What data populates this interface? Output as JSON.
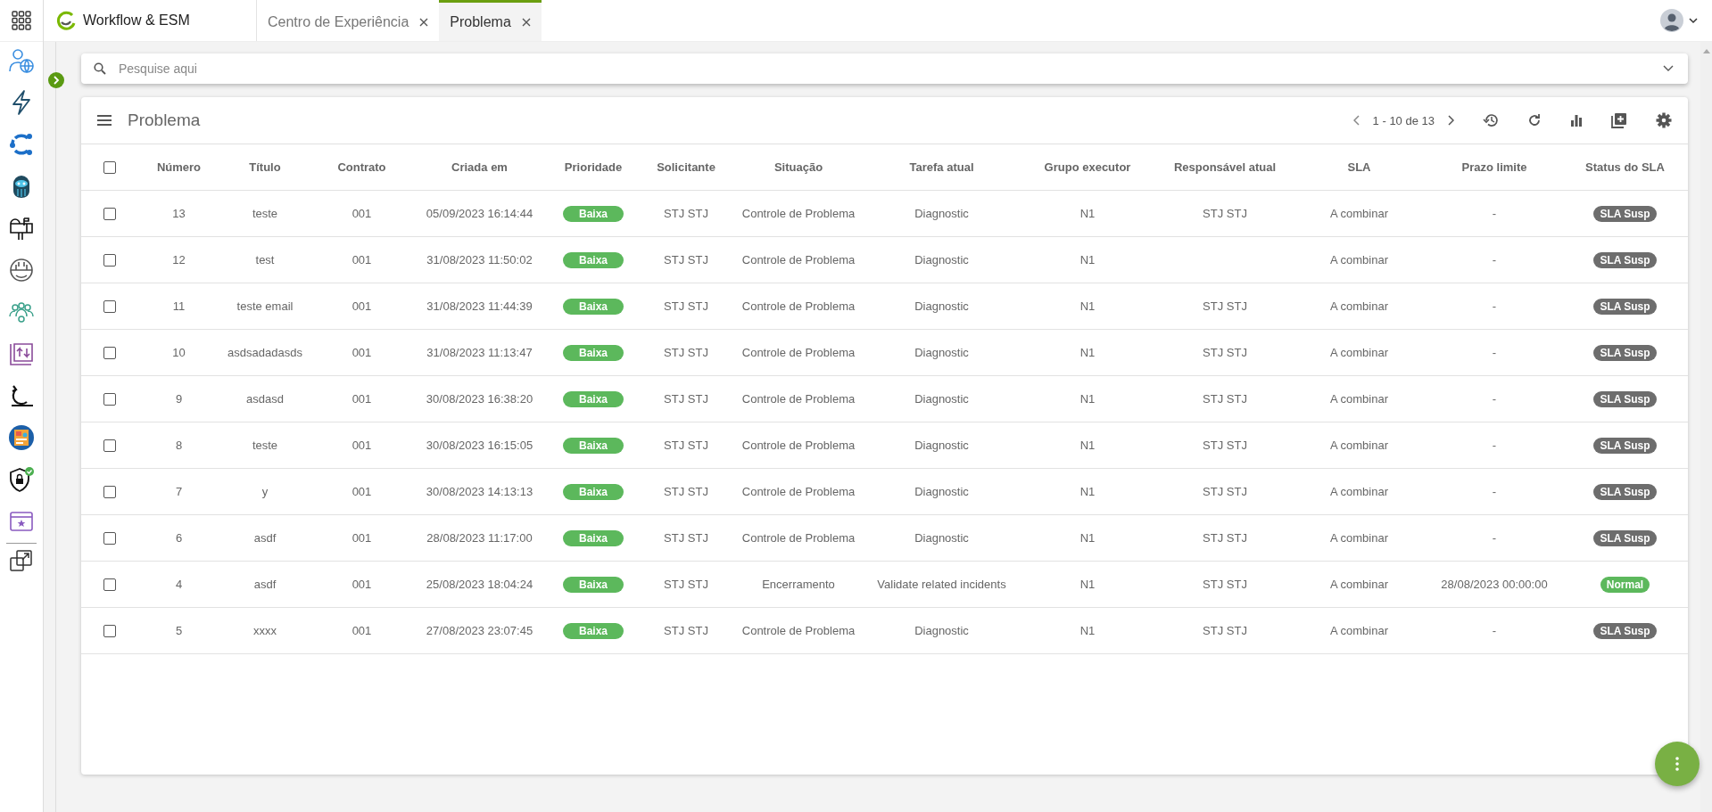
{
  "app": {
    "title": "Workflow & ESM"
  },
  "tabs": [
    {
      "label": "Centro de Experiência",
      "selected": false
    },
    {
      "label": "Problema",
      "selected": true
    }
  ],
  "search": {
    "placeholder": "Pesquise aqui"
  },
  "panel": {
    "title": "Problema",
    "pagination": "1 - 10 de 13"
  },
  "table": {
    "columns": [
      "Número",
      "Título",
      "Contrato",
      "Criada em",
      "Prioridade",
      "Solicitante",
      "Situação",
      "Tarefa atual",
      "Grupo executor",
      "Responsável atual",
      "SLA",
      "Prazo limite",
      "Status do SLA"
    ],
    "all_checked": false,
    "rows": [
      {
        "checked": false,
        "cells": [
          "13",
          "teste",
          "001",
          "05/09/2023 16:14:44",
          "Baixa",
          "STJ STJ",
          "Controle de Problema",
          "Diagnostic",
          "N1",
          "STJ STJ",
          "A combinar",
          "-"
        ],
        "status": {
          "label": "SLA Susp",
          "color": "#6d6d6d"
        }
      },
      {
        "checked": false,
        "cells": [
          "12",
          "test",
          "001",
          "31/08/2023 11:50:02",
          "Baixa",
          "STJ STJ",
          "Controle de Problema",
          "Diagnostic",
          "N1",
          null,
          "A combinar",
          "-"
        ],
        "status": {
          "label": "SLA Susp",
          "color": "#6d6d6d"
        }
      },
      {
        "checked": false,
        "cells": [
          "11",
          "teste email",
          "001",
          "31/08/2023 11:44:39",
          "Baixa",
          "STJ STJ",
          "Controle de Problema",
          "Diagnostic",
          "N1",
          "STJ STJ",
          "A combinar",
          "-"
        ],
        "status": {
          "label": "SLA Susp",
          "color": "#6d6d6d"
        }
      },
      {
        "checked": false,
        "cells": [
          "10",
          "asdsadadasds",
          "001",
          "31/08/2023 11:13:47",
          "Baixa",
          "STJ STJ",
          "Controle de Problema",
          "Diagnostic",
          "N1",
          "STJ STJ",
          "A combinar",
          "-"
        ],
        "status": {
          "label": "SLA Susp",
          "color": "#6d6d6d"
        }
      },
      {
        "checked": false,
        "cells": [
          "9",
          "asdasd",
          "001",
          "30/08/2023 16:38:20",
          "Baixa",
          "STJ STJ",
          "Controle de Problema",
          "Diagnostic",
          "N1",
          "STJ STJ",
          "A combinar",
          "-"
        ],
        "status": {
          "label": "SLA Susp",
          "color": "#6d6d6d"
        }
      },
      {
        "checked": false,
        "cells": [
          "8",
          "teste",
          "001",
          "30/08/2023 16:15:05",
          "Baixa",
          "STJ STJ",
          "Controle de Problema",
          "Diagnostic",
          "N1",
          "STJ STJ",
          "A combinar",
          "-"
        ],
        "status": {
          "label": "SLA Susp",
          "color": "#6d6d6d"
        }
      },
      {
        "checked": false,
        "cells": [
          "7",
          "y",
          "001",
          "30/08/2023 14:13:13",
          "Baixa",
          "STJ STJ",
          "Controle de Problema",
          "Diagnostic",
          "N1",
          "STJ STJ",
          "A combinar",
          "-"
        ],
        "status": {
          "label": "SLA Susp",
          "color": "#6d6d6d"
        }
      },
      {
        "checked": false,
        "cells": [
          "6",
          "asdf",
          "001",
          "28/08/2023 11:17:00",
          "Baixa",
          "STJ STJ",
          "Controle de Problema",
          "Diagnostic",
          "N1",
          "STJ STJ",
          "A combinar",
          "-"
        ],
        "status": {
          "label": "SLA Susp",
          "color": "#6d6d6d"
        }
      },
      {
        "checked": false,
        "cells": [
          "4",
          "asdf",
          "001",
          "25/08/2023 18:04:24",
          "Baixa",
          "STJ STJ",
          "Encerramento",
          "Validate related incidents",
          "N1",
          "STJ STJ",
          "A combinar",
          "28/08/2023 00:00:00"
        ],
        "status": {
          "label": "Normal",
          "color": "#5cb85c"
        }
      },
      {
        "checked": false,
        "cells": [
          "5",
          "xxxx",
          "001",
          "27/08/2023 23:07:45",
          "Baixa",
          "STJ STJ",
          "Controle de Problema",
          "Diagnostic",
          "N1",
          "STJ STJ",
          "A combinar",
          "-"
        ],
        "status": {
          "label": "SLA Susp",
          "color": "#6d6d6d"
        }
      }
    ]
  }
}
